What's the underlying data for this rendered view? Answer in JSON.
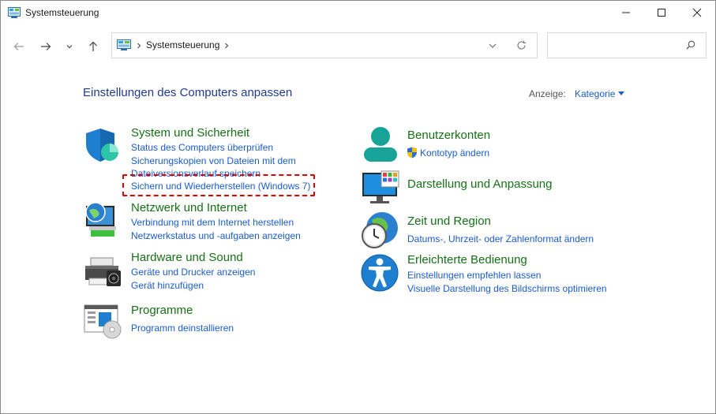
{
  "window": {
    "title": "Systemsteuerung"
  },
  "address_bar": {
    "crumb": "Systemsteuerung"
  },
  "search": {
    "placeholder": ""
  },
  "main": {
    "heading": "Einstellungen des Computers anpassen",
    "view_by_label": "Anzeige:",
    "view_by_value": "Kategorie"
  },
  "categories_left": [
    {
      "icon": "system-security-shield-icon",
      "title": "System und Sicherheit",
      "links": [
        "Status des Computers überprüfen",
        "Sicherungskopien von Dateien mit dem Dateiversionsverlauf speichern",
        "Sichern und Wiederherstellen (Windows 7)"
      ]
    },
    {
      "icon": "network-globe-icon",
      "title": "Netzwerk und Internet",
      "links": [
        "Verbindung mit dem Internet herstellen",
        "Netzwerkstatus und -aufgaben anzeigen"
      ]
    },
    {
      "icon": "printer-icon",
      "title": "Hardware und Sound",
      "links": [
        "Geräte und Drucker anzeigen",
        "Gerät hinzufügen"
      ]
    },
    {
      "icon": "programs-icon",
      "title": "Programme",
      "links": [
        "Programm deinstallieren"
      ]
    }
  ],
  "categories_right": [
    {
      "icon": "user-accounts-icon",
      "title": "Benutzerkonten",
      "links": [
        "Kontotyp ändern"
      ]
    },
    {
      "icon": "appearance-monitor-icon",
      "title": "Darstellung und Anpassung",
      "links": []
    },
    {
      "icon": "clock-globe-icon",
      "title": "Zeit und Region",
      "links": [
        "Datums-, Uhrzeit- oder Zahlenformat ändern"
      ]
    },
    {
      "icon": "accessibility-icon",
      "title": "Erleichterte Bedienung",
      "links": [
        "Einstellungen empfehlen lassen",
        "Visuelle Darstellung des Bildschirms optimieren"
      ]
    }
  ],
  "colors": {
    "heading": "#1e3c8c",
    "category_title": "#167016",
    "link": "#1a5ccc",
    "highlight": "#e00000"
  }
}
